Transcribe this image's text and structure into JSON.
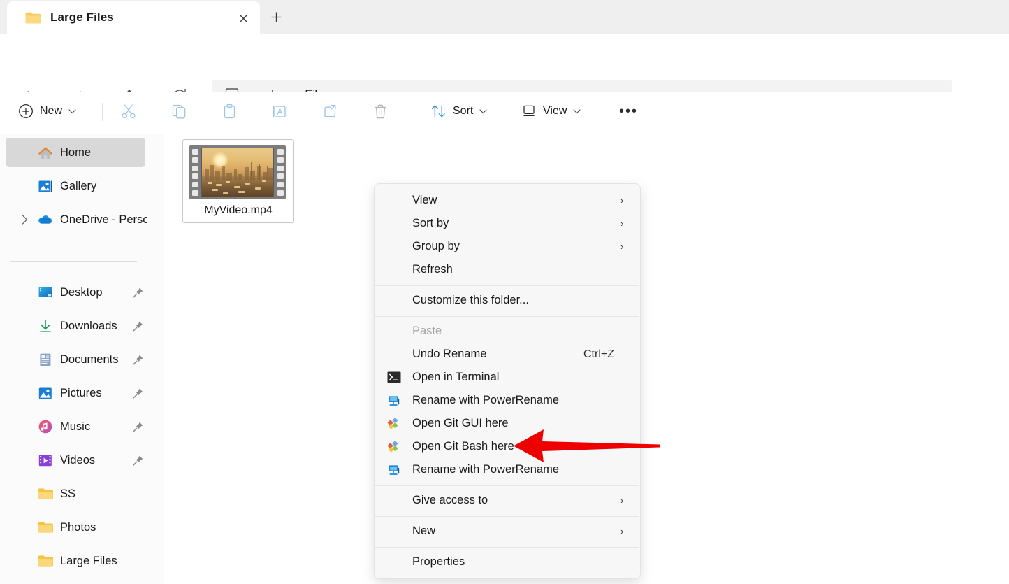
{
  "window": {
    "tab": {
      "title": "Large Files",
      "folder_icon": "folder-icon",
      "close_icon": "✕"
    },
    "new_tab_icon": "＋"
  },
  "nav": {
    "back_icon": "arrow-left-icon",
    "forward_icon": "arrow-right-icon",
    "up_icon": "arrow-up-icon",
    "refresh_icon": "refresh-icon"
  },
  "address": {
    "root_icon": "monitor-icon",
    "separator": "›",
    "crumb": "Large Files"
  },
  "toolbar": {
    "new_label": "New",
    "new_caret": "⌄",
    "cut_icon": "scissors-icon",
    "copy_icon": "copy-icon",
    "paste_icon": "clipboard-icon",
    "rename_icon": "rename-icon",
    "share_icon": "share-icon",
    "delete_icon": "trash-icon",
    "sort_label": "Sort",
    "sort_caret": "⌄",
    "view_label": "View",
    "view_caret": "⌄",
    "overflow_label": "•••"
  },
  "sidebar": {
    "items": [
      {
        "label": "Home",
        "icon": "home-icon",
        "selected": true,
        "pinned": false,
        "chevron": false
      },
      {
        "label": "Gallery",
        "icon": "gallery-icon",
        "selected": false,
        "pinned": false,
        "chevron": false
      },
      {
        "label": "OneDrive - Perso",
        "icon": "onedrive-icon",
        "selected": false,
        "pinned": false,
        "chevron": true
      },
      {
        "label": "Desktop",
        "icon": "desktop-icon",
        "selected": false,
        "pinned": true,
        "chevron": false
      },
      {
        "label": "Downloads",
        "icon": "download-icon",
        "selected": false,
        "pinned": true,
        "chevron": false
      },
      {
        "label": "Documents",
        "icon": "document-icon",
        "selected": false,
        "pinned": true,
        "chevron": false
      },
      {
        "label": "Pictures",
        "icon": "pictures-icon",
        "selected": false,
        "pinned": true,
        "chevron": false
      },
      {
        "label": "Music",
        "icon": "music-icon",
        "selected": false,
        "pinned": true,
        "chevron": false
      },
      {
        "label": "Videos",
        "icon": "videos-icon",
        "selected": false,
        "pinned": true,
        "chevron": false
      },
      {
        "label": "SS",
        "icon": "folder-icon",
        "selected": false,
        "pinned": false,
        "chevron": false
      },
      {
        "label": "Photos",
        "icon": "folder-icon",
        "selected": false,
        "pinned": false,
        "chevron": false
      },
      {
        "label": "Large Files",
        "icon": "folder-icon",
        "selected": false,
        "pinned": false,
        "chevron": false
      }
    ]
  },
  "files": [
    {
      "name": "MyVideo.mp4",
      "icon": "video-filmstrip-thumbnail"
    }
  ],
  "context_menu": {
    "items": [
      {
        "label": "View",
        "icon": "",
        "accel": "",
        "submenu": true,
        "disabled": false
      },
      {
        "label": "Sort by",
        "icon": "",
        "accel": "",
        "submenu": true,
        "disabled": false
      },
      {
        "label": "Group by",
        "icon": "",
        "accel": "",
        "submenu": true,
        "disabled": false
      },
      {
        "label": "Refresh",
        "icon": "",
        "accel": "",
        "submenu": false,
        "disabled": false
      },
      {
        "label": "Customize this folder...",
        "icon": "",
        "accel": "",
        "submenu": false,
        "disabled": false
      },
      {
        "label": "Paste",
        "icon": "",
        "accel": "",
        "submenu": false,
        "disabled": true
      },
      {
        "label": "Undo Rename",
        "icon": "",
        "accel": "Ctrl+Z",
        "submenu": false,
        "disabled": false
      },
      {
        "label": "Open in Terminal",
        "icon": "terminal-icon",
        "accel": "",
        "submenu": false,
        "disabled": false
      },
      {
        "label": "Rename with PowerRename",
        "icon": "powerrename-icon",
        "accel": "",
        "submenu": false,
        "disabled": false
      },
      {
        "label": "Open Git GUI here",
        "icon": "git-icon",
        "accel": "",
        "submenu": false,
        "disabled": false
      },
      {
        "label": "Open Git Bash here",
        "icon": "git-icon",
        "accel": "",
        "submenu": false,
        "disabled": false
      },
      {
        "label": "Rename with PowerRename",
        "icon": "powerrename-icon",
        "accel": "",
        "submenu": false,
        "disabled": false
      },
      {
        "label": "Give access to",
        "icon": "",
        "accel": "",
        "submenu": true,
        "disabled": false
      },
      {
        "label": "New",
        "icon": "",
        "accel": "",
        "submenu": true,
        "disabled": false
      },
      {
        "label": "Properties",
        "icon": "",
        "accel": "",
        "submenu": false,
        "disabled": false
      }
    ],
    "submenu_glyph": "›"
  },
  "annotation": {
    "arrow_color": "#ee0000",
    "points_at": "Open Git Bash here"
  }
}
